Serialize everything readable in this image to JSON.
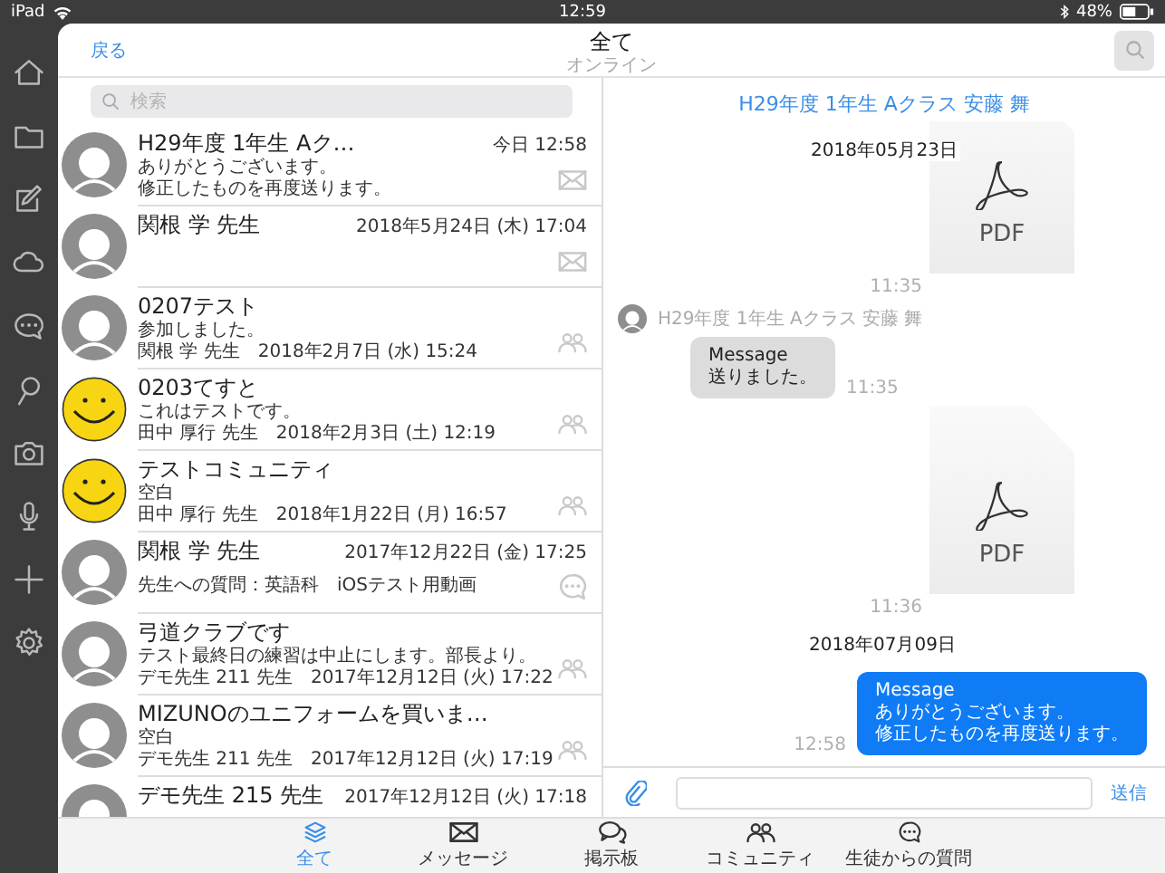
{
  "status_bar": {
    "device": "iPad",
    "time": "12:59",
    "battery": "48%"
  },
  "header": {
    "back": "戻る",
    "title": "全て",
    "subtitle": "オンライン"
  },
  "thread_list": {
    "search": {
      "placeholder": "検索"
    },
    "threads": [
      {
        "kind": "mail",
        "smiley_avatar": false,
        "title": "H29年度 1年生 Aク…",
        "time": "今日 12:58",
        "lines": [
          "ありがとうございます。",
          "修正したものを再度送ります。"
        ]
      },
      {
        "kind": "mail",
        "smiley_avatar": false,
        "title": "関根 学 先生",
        "time": "2018年5月24日 (木) 17:04"
      },
      {
        "kind": "group",
        "smiley_avatar": false,
        "title": "0207テスト",
        "lines": [
          "参加しました。"
        ],
        "sender": "関根 学 先生",
        "date": "2018年2月7日 (水) 15:24"
      },
      {
        "kind": "group",
        "smiley_avatar": true,
        "title": "0203てすと",
        "lines": [
          "これはテストです。"
        ],
        "sender": "田中 厚行 先生",
        "date": "2018年2月3日 (土) 12:19"
      },
      {
        "kind": "group",
        "smiley_avatar": true,
        "title": "テストコミュニティ",
        "lines": [
          "空白"
        ],
        "sender": "田中 厚行 先生",
        "date": "2018年1月22日 (月) 16:57"
      },
      {
        "kind": "chat",
        "smiley_avatar": false,
        "title": "関根 学 先生",
        "time": "2017年12月22日 (金) 17:25",
        "lines": [
          "先生への質問：英語科　iOSテスト用動画"
        ]
      },
      {
        "kind": "group",
        "smiley_avatar": false,
        "title": "弓道クラブです",
        "lines": [
          "テスト最終日の練習は中止にします。部長より。"
        ],
        "sender": "デモ先生 211 先生",
        "date": "2017年12月12日 (火) 17:22"
      },
      {
        "kind": "group",
        "smiley_avatar": false,
        "title": "MIZUNOのユニフォームを買いま…",
        "lines": [
          "空白"
        ],
        "sender": "デモ先生 211 先生",
        "date": "2017年12月12日 (火) 17:19"
      },
      {
        "smiley_avatar": false,
        "title": "デモ先生 215 先生",
        "time": "2017年12月12日 (火) 17:18"
      }
    ]
  },
  "chat": {
    "title": "H29年度 1年生 Aクラス 安藤 舞",
    "pinned_date": "2018年05月23日",
    "messages": [
      {
        "kind": "file",
        "label": "PDF",
        "time": "11:35"
      },
      {
        "kind": "incoming",
        "sender": "H29年度 1年生 Aクラス 安藤 舞",
        "lines": [
          "Message",
          "送りました。"
        ],
        "time": "11:35"
      },
      {
        "kind": "file",
        "label": "PDF",
        "time": "11:36"
      },
      {
        "kind": "date",
        "text": "2018年07月09日"
      },
      {
        "kind": "outgoing",
        "lines": [
          "Message",
          "ありがとうございます。",
          "修正したものを再度送ります。"
        ],
        "time": "12:58"
      }
    ],
    "composer": {
      "send": "送信"
    }
  },
  "tabs": [
    {
      "label": "全て",
      "kind": "layers",
      "selected": true
    },
    {
      "label": "メッセージ",
      "kind": "mail",
      "selected": false
    },
    {
      "label": "掲示板",
      "kind": "bubbles",
      "selected": false
    },
    {
      "label": "コミュニティ",
      "kind": "group",
      "selected": false
    },
    {
      "label": "生徒からの質問",
      "kind": "chat",
      "selected": false
    }
  ]
}
